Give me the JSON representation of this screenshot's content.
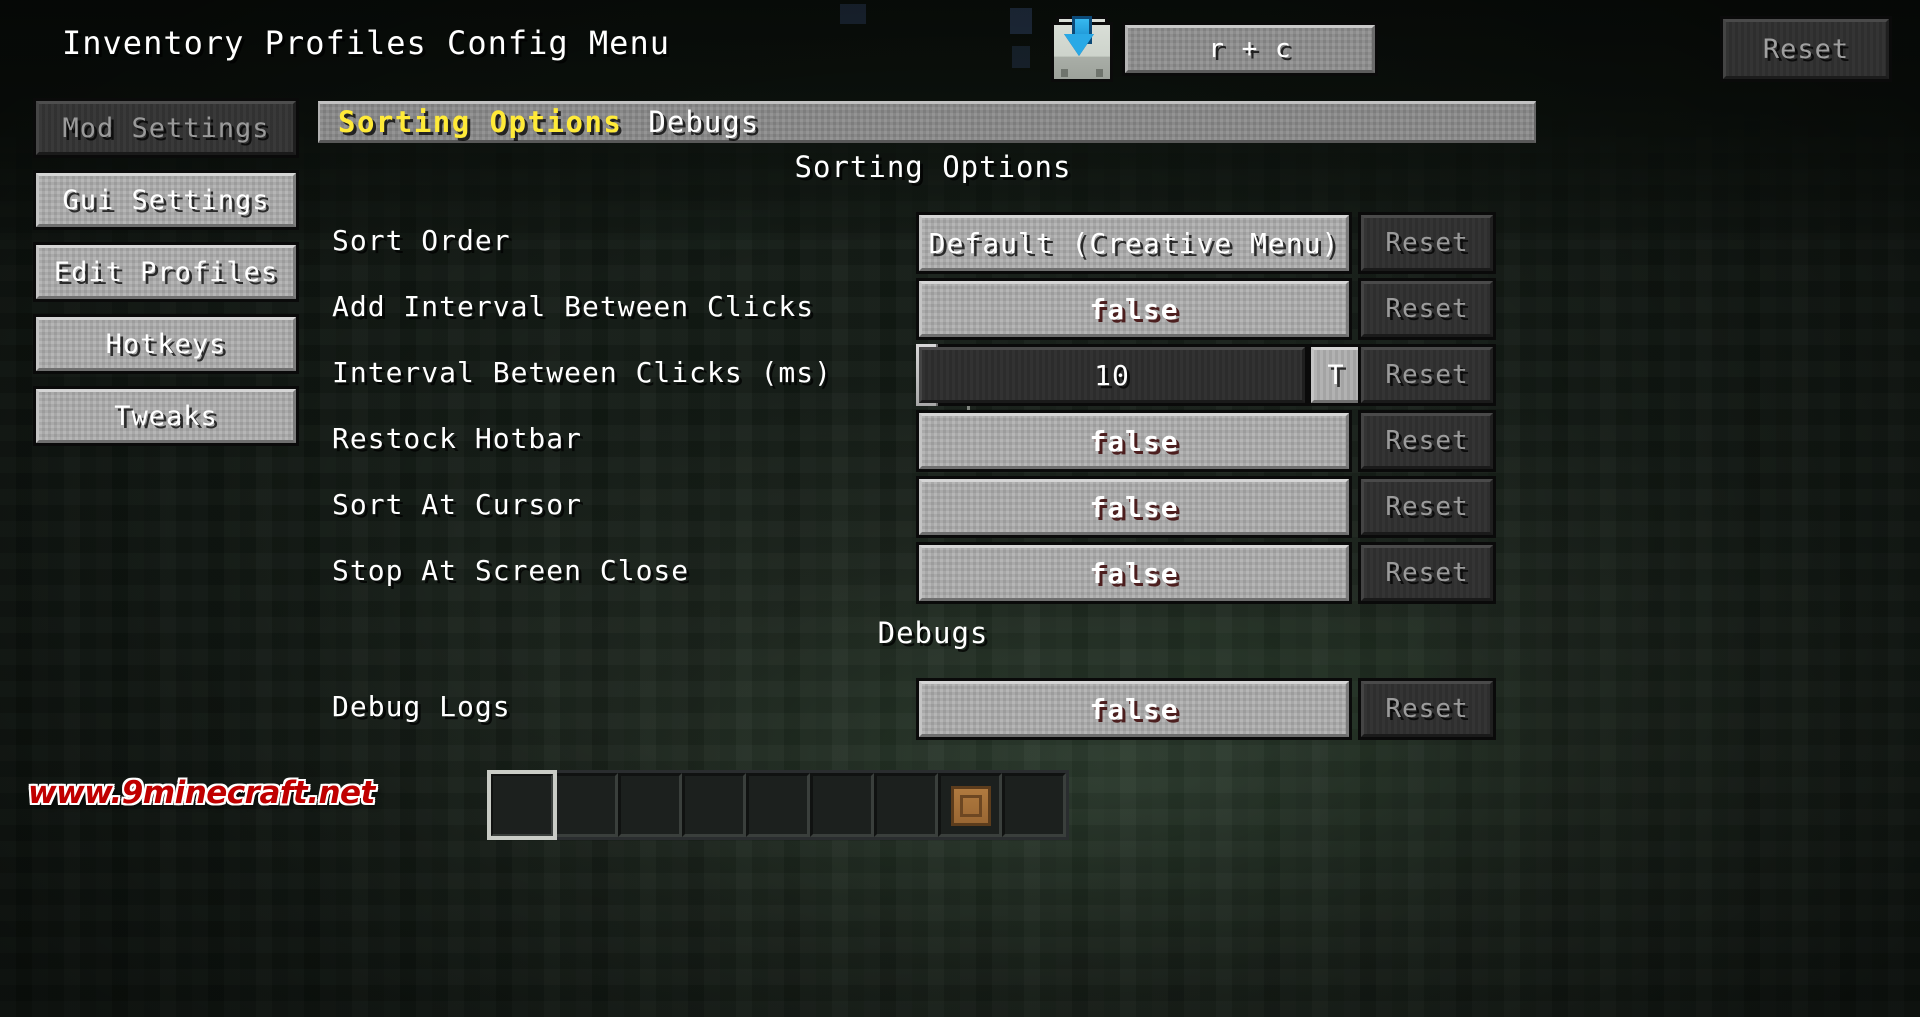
{
  "header": {
    "title": "Inventory Profiles Config Menu",
    "download_icon": "shulker-download-icon",
    "hotkey_value": "r + c",
    "reset_label": "Reset"
  },
  "sidebar": {
    "items": [
      {
        "label": "Mod Settings",
        "active": true
      },
      {
        "label": "Gui Settings",
        "active": false
      },
      {
        "label": "Edit Profiles",
        "active": false
      },
      {
        "label": "Hotkeys",
        "active": false
      },
      {
        "label": "Tweaks",
        "active": false
      }
    ]
  },
  "tabs": [
    {
      "label": "Sorting Options",
      "selected": true
    },
    {
      "label": "Debugs",
      "selected": false
    }
  ],
  "sections": [
    {
      "title": "Sorting Options",
      "rows": [
        {
          "label": "Sort Order",
          "widget": "dropdown",
          "value": "Default (Creative Menu)",
          "reset": "Reset"
        },
        {
          "label": "Add Interval Between Clicks",
          "widget": "boolean",
          "value": "false",
          "reset": "Reset"
        },
        {
          "label": "Interval Between Clicks (ms)",
          "widget": "slider",
          "value": "10",
          "text_toggle": "T",
          "reset": "Reset"
        },
        {
          "label": "Restock Hotbar",
          "widget": "boolean",
          "value": "false",
          "reset": "Reset"
        },
        {
          "label": "Sort At Cursor",
          "widget": "boolean",
          "value": "false",
          "reset": "Reset"
        },
        {
          "label": "Stop At Screen Close",
          "widget": "boolean",
          "value": "false",
          "reset": "Reset"
        }
      ]
    },
    {
      "title": "Debugs",
      "rows": [
        {
          "label": "Debug Logs",
          "widget": "boolean",
          "value": "false",
          "reset": "Reset"
        }
      ]
    }
  ],
  "hotbar": {
    "slots": [
      {
        "selected": true,
        "item": ""
      },
      {
        "selected": false,
        "item": ""
      },
      {
        "selected": false,
        "item": ""
      },
      {
        "selected": false,
        "item": ""
      },
      {
        "selected": false,
        "item": ""
      },
      {
        "selected": false,
        "item": ""
      },
      {
        "selected": false,
        "item": ""
      },
      {
        "selected": false,
        "item": "crate"
      },
      {
        "selected": false,
        "item": ""
      }
    ]
  },
  "watermark": "www.9minecraft.net",
  "colors": {
    "tab_selected": "#ffea38",
    "value_false": "#b40f0f",
    "text": "#ffffff",
    "button_face": "#adadad",
    "disabled_text": "#9a9a9a"
  }
}
